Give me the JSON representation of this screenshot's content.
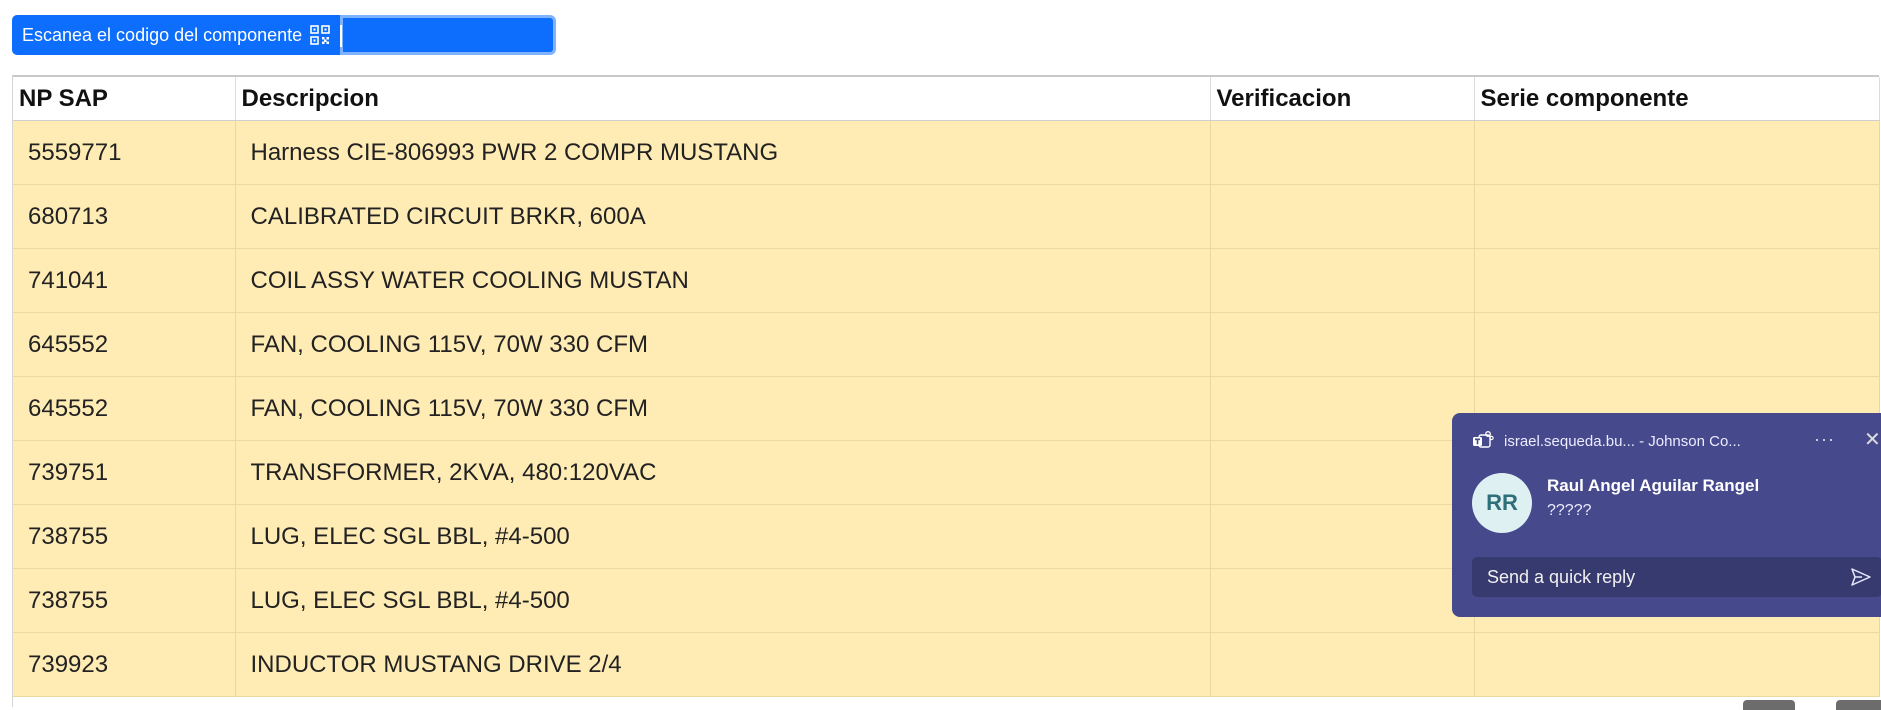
{
  "scan": {
    "label": "Escanea el codigo del componente",
    "input_value": ""
  },
  "table": {
    "headers": [
      "NP SAP",
      "Descripcion",
      "Verificacion",
      "Serie componente"
    ],
    "rows": [
      {
        "np_sap": "5559771",
        "descripcion": "Harness CIE-806993 PWR 2 COMPR MUSTANG",
        "verificacion": "",
        "serie": ""
      },
      {
        "np_sap": "680713",
        "descripcion": "CALIBRATED CIRCUIT BRKR, 600A",
        "verificacion": "",
        "serie": ""
      },
      {
        "np_sap": "741041",
        "descripcion": "COIL ASSY WATER COOLING MUSTAN",
        "verificacion": "",
        "serie": ""
      },
      {
        "np_sap": "645552",
        "descripcion": "FAN, COOLING 115V, 70W 330 CFM",
        "verificacion": "",
        "serie": ""
      },
      {
        "np_sap": "645552",
        "descripcion": "FAN, COOLING 115V, 70W 330 CFM",
        "verificacion": "",
        "serie": ""
      },
      {
        "np_sap": "739751",
        "descripcion": "TRANSFORMER, 2KVA, 480:120VAC",
        "verificacion": "",
        "serie": ""
      },
      {
        "np_sap": "738755",
        "descripcion": "LUG, ELEC SGL BBL, #4-500",
        "verificacion": "",
        "serie": ""
      },
      {
        "np_sap": "738755",
        "descripcion": "LUG, ELEC SGL BBL, #4-500",
        "verificacion": "",
        "serie": ""
      },
      {
        "np_sap": "739923",
        "descripcion": "INDUCTOR MUSTANG DRIVE 2/4",
        "verificacion": "",
        "serie": ""
      }
    ]
  },
  "toast": {
    "source": "israel.sequeda.bu... - Johnson Co...",
    "more_label": "···",
    "close_label": "✕",
    "avatar_initials": "RR",
    "sender": "Raul Angel Aguilar Rangel",
    "message": "?????",
    "reply_placeholder": "Send a quick reply",
    "bg_color": "#464a8c"
  },
  "colors": {
    "accent": "#0d6efd",
    "row_bg": "#ffecb5"
  }
}
